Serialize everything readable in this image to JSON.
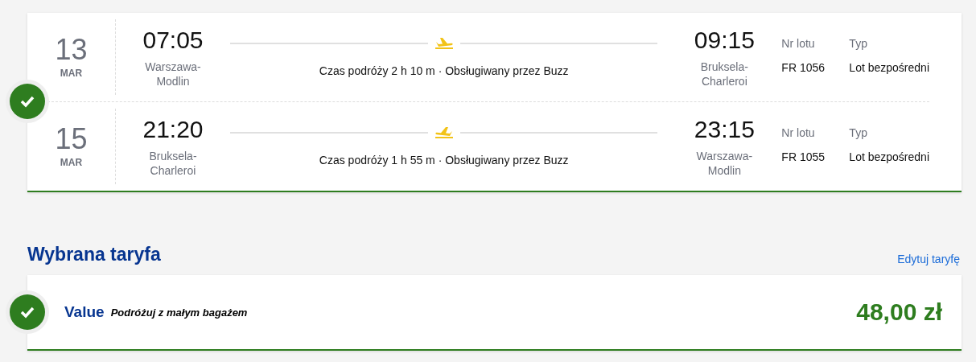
{
  "flights": [
    {
      "kind": "outbound",
      "day": "13",
      "month": "MAR",
      "departure_time": "07:05",
      "departure_airport": "Warszawa-Modlin",
      "summary": "Czas podróży 2 h 10 m · Obsługiwany przez Buzz",
      "arrival_time": "09:15",
      "arrival_airport": "Bruksela-Charleroi",
      "flight_number_label": "Nr lotu",
      "flight_number": "FR 1056",
      "type_label": "Typ",
      "type": "Lot bezpośredni"
    },
    {
      "kind": "return",
      "day": "15",
      "month": "MAR",
      "departure_time": "21:20",
      "departure_airport": "Bruksela-Charleroi",
      "summary": "Czas podróży 1 h 55 m · Obsługiwany przez Buzz",
      "arrival_time": "23:15",
      "arrival_airport": "Warszawa-Modlin",
      "flight_number_label": "Nr lotu",
      "flight_number": "FR 1055",
      "type_label": "Typ",
      "type": "Lot bezpośredni"
    }
  ],
  "flights_confirmed": true,
  "fare_section": {
    "title": "Wybrana taryfa",
    "edit_link": "Edytuj taryfę",
    "fare": {
      "name": "Value",
      "description": "Podróżuj z małym bagażem",
      "price": "48,00 zł",
      "confirmed": true
    }
  }
}
